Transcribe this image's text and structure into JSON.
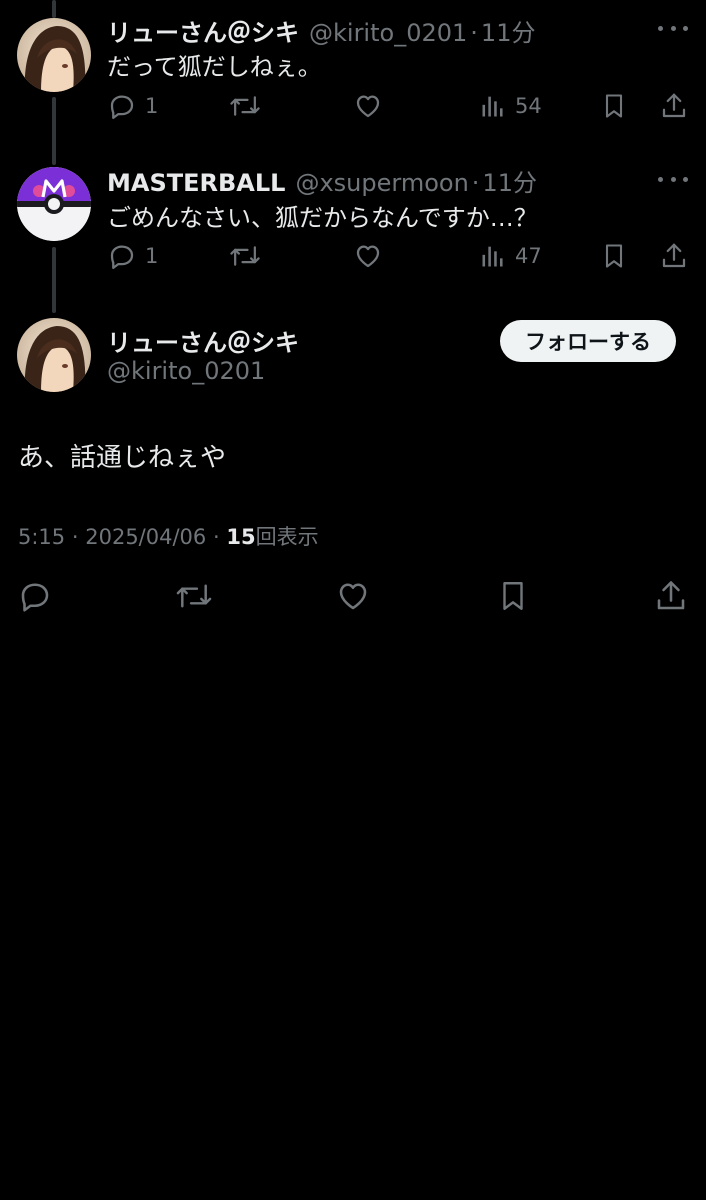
{
  "tweets": [
    {
      "display_name": "リューさん＠シキ",
      "handle": "@kirito_0201",
      "separator": "·",
      "time": "11分",
      "text": "だって狐だしねぇ。",
      "replies": "1",
      "views": "54",
      "avatar": "anime-character-avatar"
    },
    {
      "display_name": "MASTERBALL",
      "handle": "@xsupermoon",
      "separator": "·",
      "time": "11分",
      "text": "ごめんなさい、狐だからなんですか…？",
      "replies": "1",
      "views": "47",
      "avatar": "master-ball-avatar"
    }
  ],
  "focused": {
    "display_name": "リューさん＠シキ",
    "handle": "@kirito_0201",
    "follow_label": "フォローする",
    "text": "あ、話通じねぇや",
    "time": "5:15",
    "separator": "·",
    "date": "2025/04/06",
    "separator2": "·",
    "views_count": "15",
    "views_label": "回表示"
  },
  "colors": {
    "background": "#000000",
    "text": "#e7e9ea",
    "muted": "#71767b",
    "thread_line": "#333639",
    "master_ball_purple": "#7b2fd6"
  },
  "icons": [
    "reply-icon",
    "retweet-icon",
    "like-icon",
    "views-icon",
    "bookmark-icon",
    "share-icon",
    "more-icon"
  ]
}
